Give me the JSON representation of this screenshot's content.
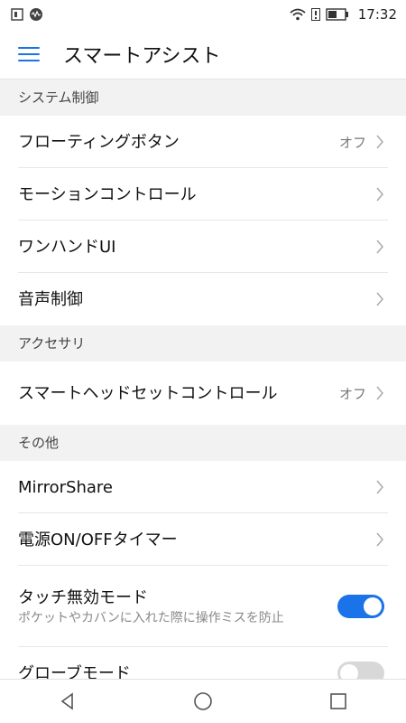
{
  "status_bar": {
    "time": "17:32"
  },
  "app_bar": {
    "title": "スマートアシスト"
  },
  "sections": [
    {
      "header": "システム制御",
      "items": [
        {
          "title": "フローティングボタン",
          "value": "オフ"
        },
        {
          "title": "モーションコントロール"
        },
        {
          "title": "ワンハンドUI"
        },
        {
          "title": "音声制御"
        }
      ]
    },
    {
      "header": "アクセサリ",
      "items": [
        {
          "title": "スマートヘッドセットコントロール",
          "value": "オフ"
        }
      ]
    },
    {
      "header": "その他",
      "items": [
        {
          "title": "MirrorShare"
        },
        {
          "title": "電源ON/OFFタイマー"
        },
        {
          "title": "タッチ無効モード",
          "subtitle": "ポケットやカバンに入れた際に操作ミスを防止",
          "toggle": true
        },
        {
          "title": "グローブモード",
          "toggle": false
        }
      ]
    }
  ],
  "colors": {
    "accent": "#1a73e8"
  }
}
